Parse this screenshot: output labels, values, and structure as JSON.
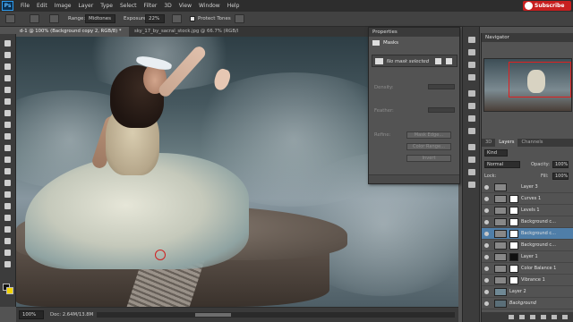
{
  "menubar": {
    "logo": "Ps",
    "items": [
      "File",
      "Edit",
      "Image",
      "Layer",
      "Type",
      "Select",
      "Filter",
      "3D",
      "View",
      "Window",
      "Help"
    ],
    "subscribe": "Subscribe"
  },
  "options": {
    "range_label": "Range:",
    "range_value": "Midtones",
    "exposure_label": "Exposure:",
    "exposure_value": "22%",
    "protect_tones": "Protect Tones"
  },
  "tabs": [
    {
      "label": "d-1 @ 100% (Background copy 2, RGB/8) *"
    },
    {
      "label": "sky_17_by_sacral_stock.jpg @ 66.7% (RGB/8#)"
    }
  ],
  "properties": {
    "title": "Properties",
    "section": "Masks",
    "no_mask": "No mask selected",
    "density": "Density:",
    "feather": "Feather:",
    "refine": "Refine:",
    "mask_edge": "Mask Edge...",
    "color_range": "Color Range...",
    "invert": "Invert"
  },
  "status": {
    "zoom": "100%",
    "doc": "Doc: 2.64M/13.8M"
  },
  "navigator": {
    "title": "Navigator"
  },
  "layers": {
    "tabs": [
      "3D",
      "Layers",
      "Channels"
    ],
    "kind": "Kind",
    "blend_mode": "Normal",
    "opacity_label": "Opacity:",
    "opacity_value": "100%",
    "lock_label": "Lock:",
    "fill_label": "Fill:",
    "fill_value": "100%",
    "items": [
      {
        "name": "Layer 3",
        "selected": false
      },
      {
        "name": "Curves 1",
        "selected": false
      },
      {
        "name": "Levels 1",
        "selected": false
      },
      {
        "name": "Background c...",
        "selected": false
      },
      {
        "name": "Background c...",
        "selected": true
      },
      {
        "name": "Background c...",
        "selected": false
      },
      {
        "name": "Layer 1",
        "selected": false
      },
      {
        "name": "Color Balance 1",
        "selected": false
      },
      {
        "name": "Vibrance 1",
        "selected": false
      },
      {
        "name": "Layer 2",
        "selected": false
      },
      {
        "name": "Background",
        "selected": false
      }
    ]
  },
  "colors": {
    "foreground": "#111111",
    "background": "#f2d300",
    "selection": "#4f7ea8",
    "accent_red": "#c81f1f"
  }
}
